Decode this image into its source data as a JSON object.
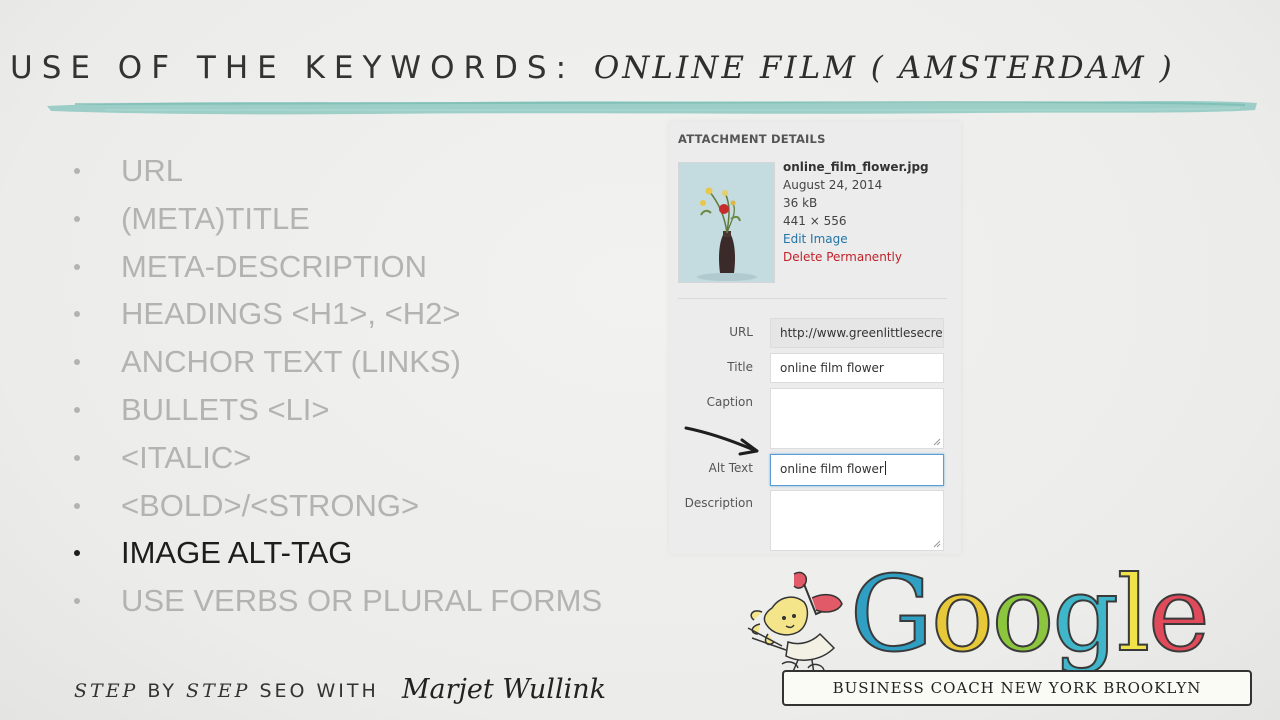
{
  "slide": {
    "title_prefix": "USE OF THE KEYWORDS:",
    "title_keyword": "ONLINE FILM ( AMSTERDAM )"
  },
  "bullets": [
    {
      "label": "URL",
      "active": false
    },
    {
      "label": "(META)TITLE",
      "active": false
    },
    {
      "label": "META-DESCRIPTION",
      "active": false
    },
    {
      "label": "HEADINGS <H1>, <H2>",
      "active": false
    },
    {
      "label": "ANCHOR TEXT (LINKS)",
      "active": false
    },
    {
      "label": "BULLETS <LI>",
      "active": false
    },
    {
      "label": "<ITALIC>",
      "active": false
    },
    {
      "label": "<BOLD>/<STRONG>",
      "active": false
    },
    {
      "label": "IMAGE ALT-TAG",
      "active": true
    },
    {
      "label": "USE VERBS OR PLURAL FORMS",
      "active": false
    }
  ],
  "attachment": {
    "heading": "ATTACHMENT DETAILS",
    "filename": "online_film_flower.jpg",
    "date": "August 24, 2014",
    "size": "36 kB",
    "dimensions": "441 × 556",
    "edit_link": "Edit Image",
    "delete_link": "Delete Permanently",
    "fields": {
      "url_label": "URL",
      "url_value": "http://www.greenlittlesecret",
      "title_label": "Title",
      "title_value": "online film flower",
      "caption_label": "Caption",
      "caption_value": "",
      "alt_label": "Alt Text",
      "alt_value": "online film flower",
      "description_label": "Description",
      "description_value": ""
    }
  },
  "footer": {
    "step1": "STEP",
    "by": "BY",
    "step2": "STEP",
    "seo_with": "SEO WITH",
    "signature": "Marjet Wullink"
  },
  "logo": {
    "letters": [
      "G",
      "o",
      "o",
      "g",
      "l",
      "e"
    ],
    "letter_colors": [
      "#2f9fc4",
      "#e6c838",
      "#8cc63e",
      "#3fb6c9",
      "#f1e24a",
      "#e04a5a"
    ],
    "banner": "BUSINESS COACH NEW YORK BROOKLYN"
  },
  "colors": {
    "brush_stroke": "#8ec9c1",
    "bullet_inactive": "#b3b3b3",
    "bullet_active": "#1d1d1d",
    "link_blue": "#2274a6",
    "link_red": "#c0222a",
    "focus_border": "#5b9dd9"
  }
}
